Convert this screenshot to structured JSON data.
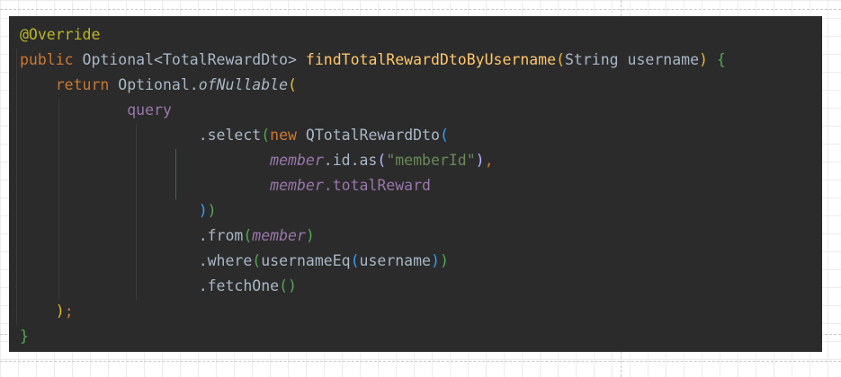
{
  "editor": {
    "background": "#2b2b2b",
    "lines": [
      [
        {
          "t": "@Override",
          "c": "ann"
        }
      ],
      [
        {
          "t": "public ",
          "c": "kw"
        },
        {
          "t": "Optional<TotalRewardDto> ",
          "c": "type"
        },
        {
          "t": "findTotalRewardDtoByUsername",
          "c": "fn"
        },
        {
          "t": "(",
          "c": "p1"
        },
        {
          "t": "String username",
          "c": "plain"
        },
        {
          "t": ")",
          "c": "p1"
        },
        {
          "t": " ",
          "c": "plain"
        },
        {
          "t": "{",
          "c": "p2"
        }
      ],
      [
        {
          "t": "    ",
          "c": "plain"
        },
        {
          "t": "return ",
          "c": "kw"
        },
        {
          "t": "Optional.",
          "c": "plain"
        },
        {
          "t": "ofNullable",
          "c": "italic-fn"
        },
        {
          "t": "(",
          "c": "p1"
        }
      ],
      [
        {
          "t": "            ",
          "c": "plain"
        },
        {
          "t": "query",
          "c": "field"
        }
      ],
      [
        {
          "t": "                    ",
          "c": "plain"
        },
        {
          "t": ".select",
          "c": "plain"
        },
        {
          "t": "(",
          "c": "p2"
        },
        {
          "t": "new ",
          "c": "kw"
        },
        {
          "t": "QTotalRewardDto",
          "c": "plain"
        },
        {
          "t": "(",
          "c": "p3"
        }
      ],
      [
        {
          "t": "                            ",
          "c": "plain"
        },
        {
          "t": "member",
          "c": "field-i"
        },
        {
          "t": ".id.as",
          "c": "plain"
        },
        {
          "t": "(",
          "c": "p4"
        },
        {
          "t": "\"memberId\"",
          "c": "str"
        },
        {
          "t": ")",
          "c": "p4"
        },
        {
          "t": ",",
          "c": "kw"
        }
      ],
      [
        {
          "t": "                            ",
          "c": "plain"
        },
        {
          "t": "member",
          "c": "field-i"
        },
        {
          "t": ".totalReward",
          "c": "field"
        }
      ],
      [
        {
          "t": "                    ",
          "c": "plain"
        },
        {
          "t": ")",
          "c": "p3"
        },
        {
          "t": ")",
          "c": "p2"
        }
      ],
      [
        {
          "t": "                    ",
          "c": "plain"
        },
        {
          "t": ".from",
          "c": "plain"
        },
        {
          "t": "(",
          "c": "p2"
        },
        {
          "t": "member",
          "c": "field-i"
        },
        {
          "t": ")",
          "c": "p2"
        }
      ],
      [
        {
          "t": "                    ",
          "c": "plain"
        },
        {
          "t": ".where",
          "c": "plain"
        },
        {
          "t": "(",
          "c": "p2"
        },
        {
          "t": "usernameEq",
          "c": "plain"
        },
        {
          "t": "(",
          "c": "p3"
        },
        {
          "t": "username",
          "c": "plain"
        },
        {
          "t": ")",
          "c": "p3"
        },
        {
          "t": ")",
          "c": "p2"
        }
      ],
      [
        {
          "t": "                    ",
          "c": "plain"
        },
        {
          "t": ".fetchOne",
          "c": "plain"
        },
        {
          "t": "()",
          "c": "p2"
        }
      ],
      [
        {
          "t": "    ",
          "c": "plain"
        },
        {
          "t": ")",
          "c": "p1"
        },
        {
          "t": ";",
          "c": "kw"
        }
      ],
      [
        {
          "t": "}",
          "c": "p2"
        }
      ]
    ]
  }
}
